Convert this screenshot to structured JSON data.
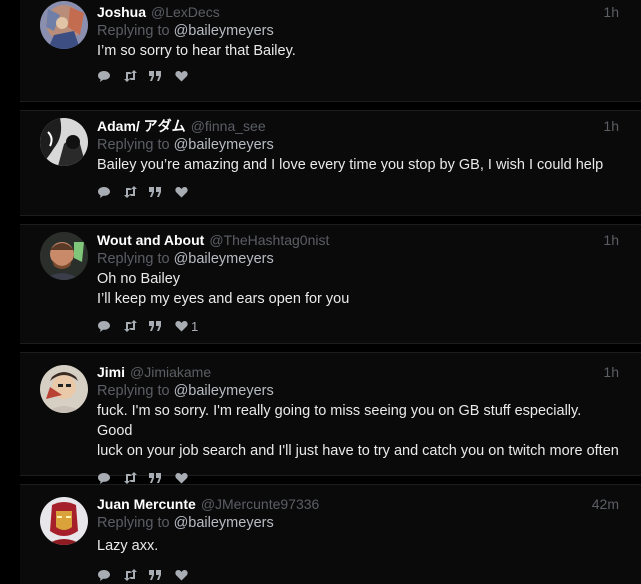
{
  "tweets": [
    {
      "name": "Joshua",
      "handle": "@LexDecs",
      "time": "1h",
      "replying_prefix": "Replying to",
      "replying_to": "@baileymeyers",
      "text": [
        "I’m so sorry to hear that Bailey."
      ],
      "likes": ""
    },
    {
      "name": "Adam/ アダム",
      "handle": "@finna_see",
      "time": "1h",
      "replying_prefix": "Replying to",
      "replying_to": "@baileymeyers",
      "text": [
        "Bailey you’re amazing and I love every time you stop by GB, I wish I could help"
      ],
      "likes": ""
    },
    {
      "name": "Wout and About",
      "handle": "@TheHashtag0nist",
      "time": "1h",
      "replying_prefix": "Replying to",
      "replying_to": "@baileymeyers",
      "text": [
        "Oh no Bailey",
        "I’ll keep my eyes and ears open for you"
      ],
      "likes": "1"
    },
    {
      "name": "Jimi",
      "handle": "@Jimiakame",
      "time": "1h",
      "replying_prefix": "Replying to",
      "replying_to": "@baileymeyers",
      "text": [
        "fuck. I'm so sorry. I'm really going to miss seeing you on GB stuff especially. Good",
        "luck on your job search and I'll just have to try and catch you on twitch more often"
      ],
      "likes": ""
    },
    {
      "name": "Juan Mercunte",
      "handle": "@JMercunte97336",
      "time": "42m",
      "replying_prefix": "Replying to",
      "replying_to": "@baileymeyers",
      "text": [
        "Lazy axx."
      ],
      "likes": ""
    }
  ],
  "icons": {
    "reply": "reply-icon",
    "retweet": "retweet-icon",
    "quote": "quote-icon",
    "like": "heart-icon"
  },
  "colors": {
    "background": "#000000",
    "card": "#0a0a0a",
    "muted": "#5b5e64",
    "name": "#ffffff"
  }
}
